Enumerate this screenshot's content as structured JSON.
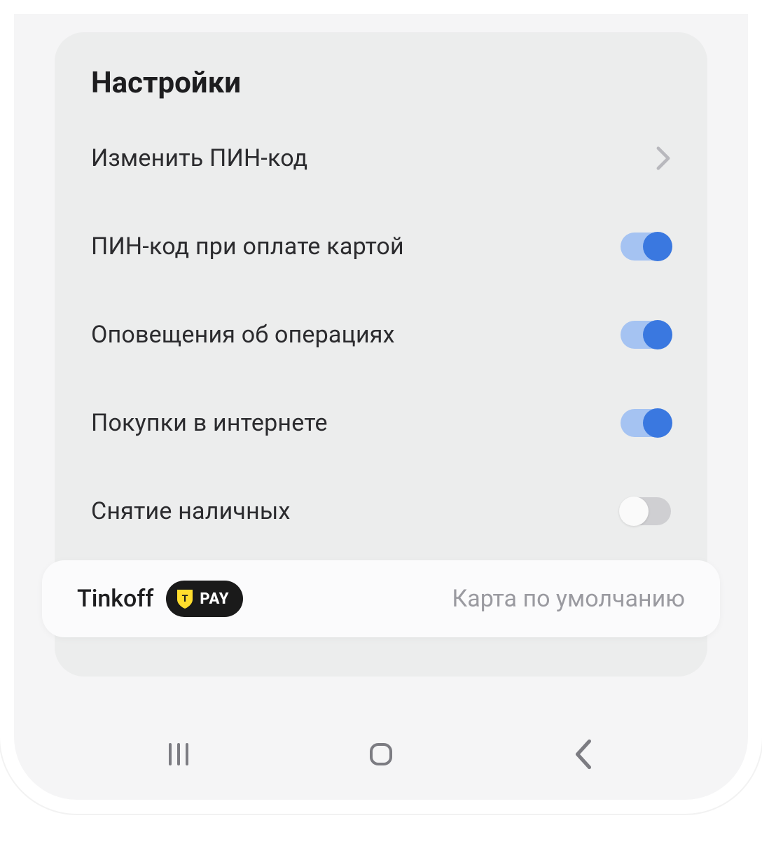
{
  "settings": {
    "title": "Настройки",
    "rows": [
      {
        "label": "Изменить ПИН-код",
        "type": "link"
      },
      {
        "label": "ПИН-код при оплате картой",
        "type": "toggle",
        "on": true
      },
      {
        "label": "Оповещения об операциях",
        "type": "toggle",
        "on": true
      },
      {
        "label": "Покупки в интернете",
        "type": "toggle",
        "on": true
      },
      {
        "label": "Снятие наличных",
        "type": "toggle",
        "on": false
      }
    ]
  },
  "banner": {
    "brand": "Tinkoff",
    "badge_pay": "PAY",
    "right_text": "Карта по умолчанию"
  }
}
